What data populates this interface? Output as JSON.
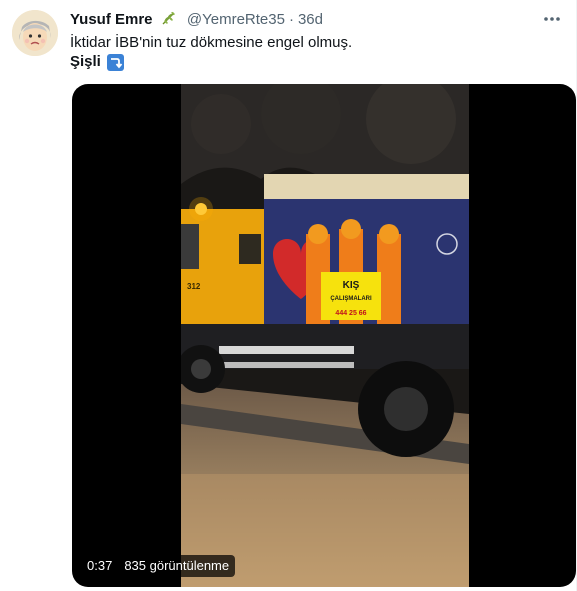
{
  "tweet": {
    "author_name": "Yusuf Emre",
    "handle": "@YemreRte35",
    "separator": "·",
    "time": "36d",
    "text_line1": "İktidar İBB'nin tuz dökmesine engel olmuş.",
    "text_line2": "Şişli",
    "emoji_icon": "right-arrow-curving-down-icon",
    "more_icon": "more-options-icon"
  },
  "video": {
    "duration": "0:37",
    "views": "835 görüntülenme",
    "truck_sign": {
      "title": "KIŞ",
      "subtitle": "ÇALIŞMALARI",
      "phone": "444 25 66",
      "plate": "312"
    }
  },
  "colors": {
    "accent": "#1d9bf0",
    "text_secondary": "#536471",
    "truck_yellow": "#e8a20c",
    "truck_blue": "#2b3470"
  }
}
